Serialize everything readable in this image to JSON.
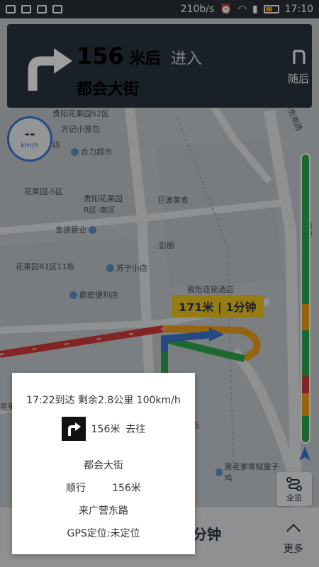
{
  "status_bar": {
    "speed": "210b/s",
    "time": "17:10"
  },
  "nav_banner": {
    "distance": "156",
    "distance_unit": "米后",
    "action": "进入",
    "road": "都会大街",
    "next_label": "随后"
  },
  "speedometer": {
    "value": "--",
    "unit": "km/h"
  },
  "map": {
    "distance_badge": "171米 | 1分钟",
    "pois": [
      "贵阳花果园52区",
      "方记小笼包",
      "店",
      "合力超市",
      "花果园-S区",
      "贵阳花果园R区-南区",
      "巨波美食",
      "金德管业",
      "彭厨",
      "花果园R1区11栋",
      "苏宁小店",
      "骏怡连锁酒店",
      "鼎宏便利店",
      "黄老爹青椒童子鸡",
      "甲秀南路",
      "甲秀",
      "西",
      "花果"
    ]
  },
  "traffic_bar": {
    "colors": [
      "#2fa84f",
      "#f0a21a",
      "#2fa84f",
      "#d33b3b",
      "#f0a21a",
      "#2fa84f"
    ],
    "fractions": [
      0.52,
      0.09,
      0.16,
      0.06,
      0.08,
      0.09
    ]
  },
  "overview_button": {
    "label": "全览"
  },
  "bottom_bar": {
    "time_remaining": "分钟",
    "more_label": "更多"
  },
  "info_card": {
    "eta_line": "17:22到达   剩余2.8公里   100km/h",
    "turn_distance": "156米",
    "turn_action": "去往",
    "road": "都会大街",
    "forward_label": "顺行",
    "forward_distance": "156米",
    "from_road": "来广营东路",
    "gps_status": "GPS定位:未定位"
  },
  "colors": {
    "banner_bg": "#2b3440",
    "route_blue": "#3a78d4",
    "route_red": "#d33b3b",
    "route_yellow": "#f0a21a",
    "route_green": "#2fa84f"
  }
}
